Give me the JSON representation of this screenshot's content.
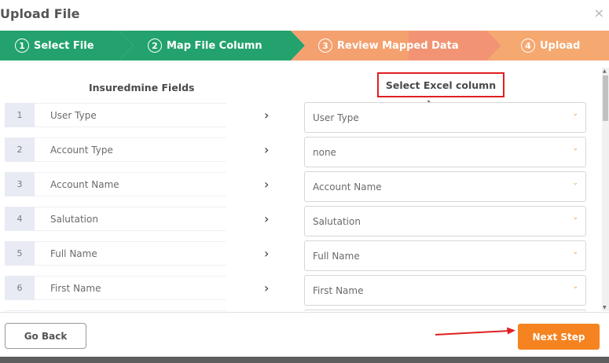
{
  "modal": {
    "title": "Upload File",
    "close_glyph": "×"
  },
  "steps": [
    {
      "number": "1",
      "label": "Select File",
      "color": "#23a26d"
    },
    {
      "number": "2",
      "label": "Map File Column",
      "color": "#23a26d"
    },
    {
      "number": "3",
      "label": "Review Mapped Data",
      "color": "#f4a06f"
    },
    {
      "number": "4",
      "label": "Upload",
      "color": "#f4a06f"
    }
  ],
  "columns": {
    "left_header": "Insuredmine Fields",
    "right_header": "Select Excel column"
  },
  "rows": [
    {
      "index": "1",
      "field": "User Type",
      "mapped": "User Type"
    },
    {
      "index": "2",
      "field": "Account Type",
      "mapped": "none"
    },
    {
      "index": "3",
      "field": "Account Name",
      "mapped": "Account Name"
    },
    {
      "index": "4",
      "field": "Salutation",
      "mapped": "Salutation"
    },
    {
      "index": "5",
      "field": "Full Name",
      "mapped": "Full Name"
    },
    {
      "index": "6",
      "field": "First Name",
      "mapped": "First Name"
    }
  ],
  "icons": {
    "row_arrow": "chevron-right-icon",
    "select_caret": "chevron-down-icon",
    "close": "close-icon"
  },
  "footer": {
    "back_label": "Go Back",
    "next_label": "Next Step"
  },
  "colors": {
    "accent_green": "#23a26d",
    "accent_orange": "#f5831f",
    "highlight_red": "#e02020"
  }
}
